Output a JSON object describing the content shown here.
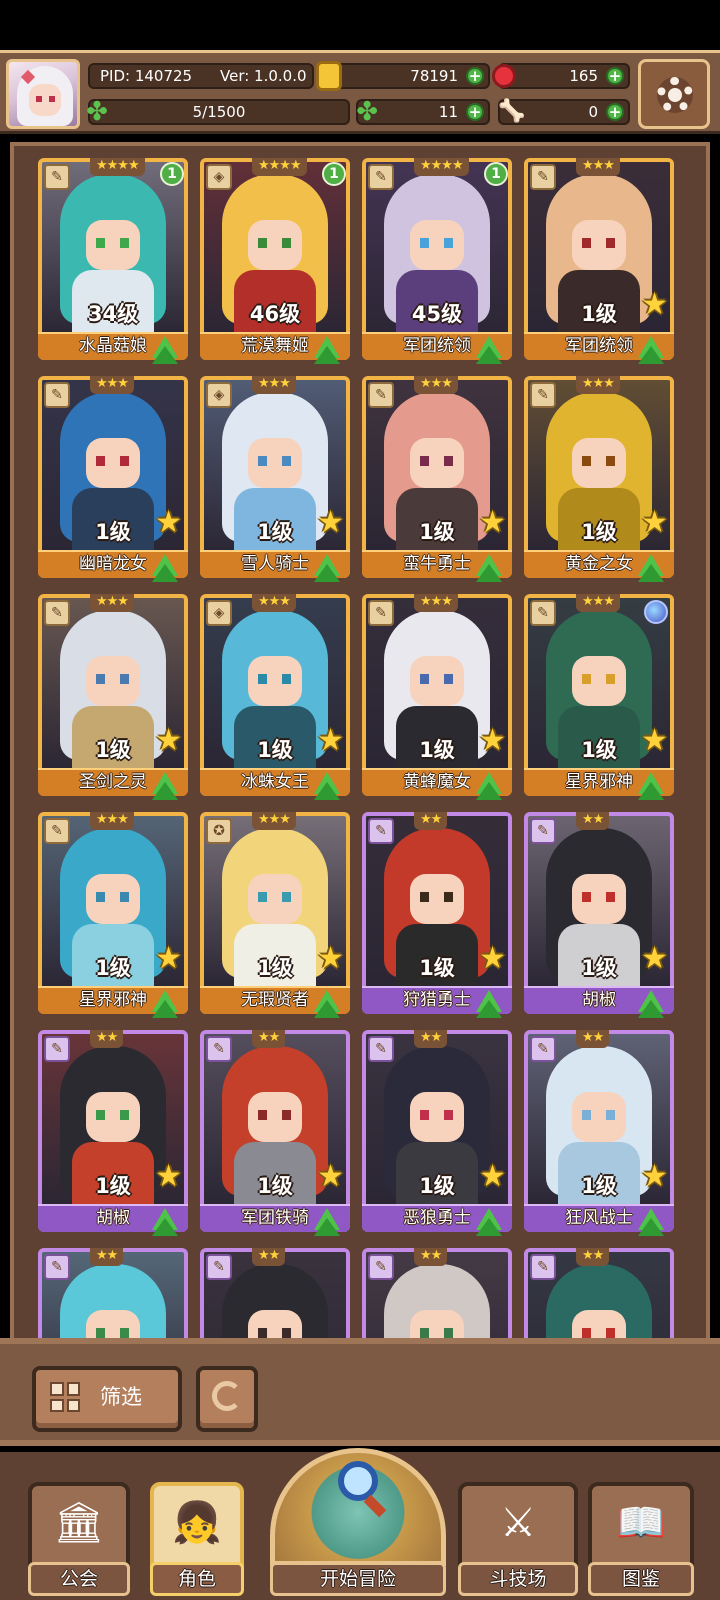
{
  "header": {
    "pid": "PID: 140725",
    "version": "Ver: 1.0.0.0",
    "exp": "5/1500",
    "gold": "78191",
    "gems": "165",
    "clover": "11",
    "pet_food": "0"
  },
  "cards": [
    {
      "name": "水晶菇娘",
      "level": "34级",
      "stars": "★★★★",
      "badge": "1",
      "frame": "gold",
      "role": "✎",
      "hair": "#3bb8b0",
      "eye": "#3ea84a",
      "body": "#dfe7ef"
    },
    {
      "name": "荒漠舞姬",
      "level": "46级",
      "stars": "★★★★",
      "badge": "1",
      "frame": "gold",
      "role": "◈",
      "hair": "#f2c04a",
      "eye": "#3a8a3a",
      "body": "#b3302a"
    },
    {
      "name": "军团统领",
      "level": "45级",
      "stars": "★★★★",
      "badge": "1",
      "frame": "gold",
      "role": "✎",
      "hair": "#cfc3df",
      "eye": "#4aa3d8",
      "body": "#5a3f7c"
    },
    {
      "name": "军团统领",
      "level": "1级",
      "stars": "★★★",
      "badge": "",
      "frame": "gold",
      "role": "✎",
      "hair": "#e8b88c",
      "eye": "#a02a2a",
      "body": "#3a2a2a"
    },
    {
      "name": "幽暗龙女",
      "level": "1级",
      "stars": "★★★",
      "badge": "",
      "frame": "gold",
      "role": "✎",
      "hair": "#2f74b6",
      "eye": "#b02a3a",
      "body": "#2a3f5c"
    },
    {
      "name": "雪人骑士",
      "level": "1级",
      "stars": "★★★",
      "badge": "",
      "frame": "gold",
      "role": "◈",
      "hair": "#dfe8f2",
      "eye": "#4a8ac0",
      "body": "#7fb6e0"
    },
    {
      "name": "蛮牛勇士",
      "level": "1级",
      "stars": "★★★",
      "badge": "",
      "frame": "gold",
      "role": "✎",
      "hair": "#e49a8c",
      "eye": "#7a2a4a",
      "body": "#4a3a3a"
    },
    {
      "name": "黄金之女",
      "level": "1级",
      "stars": "★★★",
      "badge": "",
      "frame": "gold",
      "role": "✎",
      "hair": "#e0b42e",
      "eye": "#8a4a10",
      "body": "#b08a1a"
    },
    {
      "name": "圣剑之灵",
      "level": "1级",
      "stars": "★★★",
      "badge": "",
      "frame": "gold",
      "role": "✎",
      "hair": "#d8dde6",
      "eye": "#4a7ab0",
      "body": "#c4a870"
    },
    {
      "name": "冰蛛女王",
      "level": "1级",
      "stars": "★★★",
      "badge": "",
      "frame": "gold",
      "role": "◈",
      "hair": "#58b8d8",
      "eye": "#2a8aa8",
      "body": "#2a5a6a"
    },
    {
      "name": "黄蜂魔女",
      "level": "1级",
      "stars": "★★★",
      "badge": "",
      "frame": "gold",
      "role": "✎",
      "hair": "#e8e8ee",
      "eye": "#4a6ab0",
      "body": "#2a2a30"
    },
    {
      "name": "星界邪神",
      "level": "1级",
      "stars": "★★★",
      "badge": "orb",
      "frame": "gold",
      "role": "✎",
      "hair": "#2f6a52",
      "eye": "#d8a02a",
      "body": "#2a5a4a"
    },
    {
      "name": "星界邪神",
      "level": "1级",
      "stars": "★★★",
      "badge": "",
      "frame": "gold",
      "role": "✎",
      "hair": "#3aa8c8",
      "eye": "#3a8ab0",
      "body": "#8ad0e0"
    },
    {
      "name": "无瑕贤者",
      "level": "1级",
      "stars": "★★★",
      "badge": "",
      "frame": "gold",
      "role": "✪",
      "hair": "#f2d47a",
      "eye": "#3a9ab0",
      "body": "#f0efe6"
    },
    {
      "name": "狩猎勇士",
      "level": "1级",
      "stars": "★★",
      "badge": "",
      "frame": "purple",
      "role": "✎",
      "hair": "#c43a2a",
      "eye": "#3a2a1a",
      "body": "#2a2a2a"
    },
    {
      "name": "胡椒",
      "level": "1级",
      "stars": "★★",
      "badge": "",
      "frame": "purple",
      "role": "✎",
      "hair": "#2a2a30",
      "eye": "#c0302a",
      "body": "#cfcfd2"
    },
    {
      "name": "胡椒",
      "level": "1级",
      "stars": "★★",
      "badge": "",
      "frame": "purple",
      "role": "✎",
      "hair": "#2a2a30",
      "eye": "#3a9a4a",
      "body": "#c4402a"
    },
    {
      "name": "军团铁骑",
      "level": "1级",
      "stars": "★★",
      "badge": "",
      "frame": "purple",
      "role": "✎",
      "hair": "#c4402a",
      "eye": "#8a2a2a",
      "body": "#8a8a92"
    },
    {
      "name": "恶狼勇士",
      "level": "1级",
      "stars": "★★",
      "badge": "",
      "frame": "purple",
      "role": "✎",
      "hair": "#2a2a3a",
      "eye": "#c0304a",
      "body": "#3a3a40"
    },
    {
      "name": "狂风战士",
      "level": "1级",
      "stars": "★★",
      "badge": "",
      "frame": "purple",
      "role": "✎",
      "hair": "#d8e6f2",
      "eye": "#7ab0d8",
      "body": "#a8c8e0"
    },
    {
      "name": "",
      "level": "",
      "stars": "★★",
      "badge": "",
      "frame": "purple",
      "role": "✎",
      "hair": "#5ac8d8",
      "eye": "#3a8a4a",
      "body": "#8ad8e8"
    },
    {
      "name": "",
      "level": "",
      "stars": "★★",
      "badge": "",
      "frame": "purple",
      "role": "✎",
      "hair": "#2a2a30",
      "eye": "#3a2a2a",
      "body": "#3a3a3a"
    },
    {
      "name": "",
      "level": "",
      "stars": "★★",
      "badge": "",
      "frame": "purple",
      "role": "✎",
      "hair": "#cfc8c4",
      "eye": "#3a7a4a",
      "body": "#5a5050"
    },
    {
      "name": "",
      "level": "",
      "stars": "★★",
      "badge": "",
      "frame": "purple",
      "role": "✎",
      "hair": "#2a6a62",
      "eye": "#c0302a",
      "body": "#2a4a4a"
    }
  ],
  "filter": {
    "label": "筛选"
  },
  "nav": [
    {
      "label": "公会",
      "icon": "guild-icon",
      "glyph": "🏛"
    },
    {
      "label": "角色",
      "icon": "character-icon",
      "glyph": "👧"
    },
    {
      "label": "开始冒险",
      "icon": "adventure-map-icon",
      "glyph": ""
    },
    {
      "label": "斗技场",
      "icon": "arena-swords-icon",
      "glyph": "⚔"
    },
    {
      "label": "图鉴",
      "icon": "codex-book-icon",
      "glyph": "📖"
    }
  ]
}
